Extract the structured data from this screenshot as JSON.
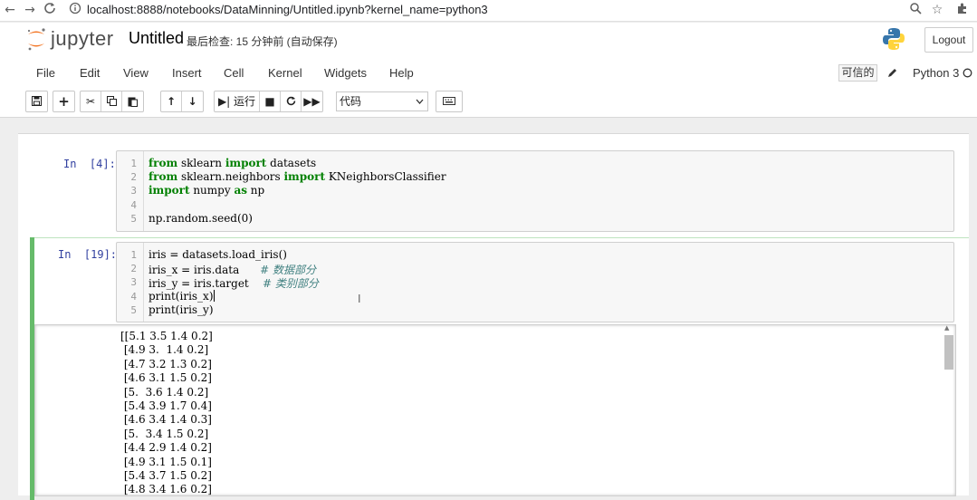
{
  "browser": {
    "url": "localhost:8888/notebooks/DataMinning/Untitled.ipynb?kernel_name=python3",
    "icons": [
      "back-arrow-icon",
      "forward-arrow-icon",
      "reload-icon",
      "info-icon",
      "zoom-icon",
      "star-icon",
      "extension-icon"
    ]
  },
  "header": {
    "logo_text": "jupyter",
    "title": "Untitled",
    "save_status": "最后检查: 15 分钟前  (自动保存)",
    "logout_label": "Logout"
  },
  "menu": {
    "items": [
      "File",
      "Edit",
      "View",
      "Insert",
      "Cell",
      "Kernel",
      "Widgets",
      "Help"
    ],
    "trusted": "可信的",
    "kernel": "Python 3"
  },
  "toolbar": {
    "run_label": "运行",
    "cell_type": "代码"
  },
  "cells": [
    {
      "prompt": "In  [4]:",
      "line_numbers": [
        "1",
        "2",
        "3",
        "4",
        "5"
      ],
      "lines": {
        "l1_kw1": "from",
        "l1_a": " sklearn ",
        "l1_kw2": "import",
        "l1_b": " datasets",
        "l2_kw1": "from",
        "l2_a": " sklearn.neighbors ",
        "l2_kw2": "import",
        "l2_b": " KNeighborsClassifier",
        "l3_kw1": "import",
        "l3_a": " numpy ",
        "l3_kw2": "as",
        "l3_b": " np",
        "l5": "np.random.seed(0)"
      }
    },
    {
      "prompt": "In  [19]:",
      "line_numbers": [
        "1",
        "2",
        "3",
        "4",
        "5"
      ],
      "lines": {
        "l1": "iris = datasets.load_iris()",
        "l2_code": "iris_x = iris.data      ",
        "l2_comment": "# 数据部分",
        "l3_code": "iris_y = iris.target    ",
        "l3_comment": "# 类别部分",
        "l4": "print(iris_x)",
        "l5": "print(iris_y)"
      }
    }
  ],
  "output": {
    "lines": [
      "[[5.1 3.5 1.4 0.2]",
      " [4.9 3.  1.4 0.2]",
      " [4.7 3.2 1.3 0.2]",
      " [4.6 3.1 1.5 0.2]",
      " [5.  3.6 1.4 0.2]",
      " [5.4 3.9 1.7 0.4]",
      " [4.6 3.4 1.4 0.3]",
      " [5.  3.4 1.5 0.2]",
      " [4.4 2.9 1.4 0.2]",
      " [4.9 3.1 1.5 0.1]",
      " [5.4 3.7 1.5 0.2]",
      " [4.8 3.4 1.6 0.2]"
    ]
  },
  "colors": {
    "selected_cell_bar": "#66bb6a",
    "prompt": "#303f9f",
    "keyword": "#008000",
    "comment": "#408080"
  }
}
